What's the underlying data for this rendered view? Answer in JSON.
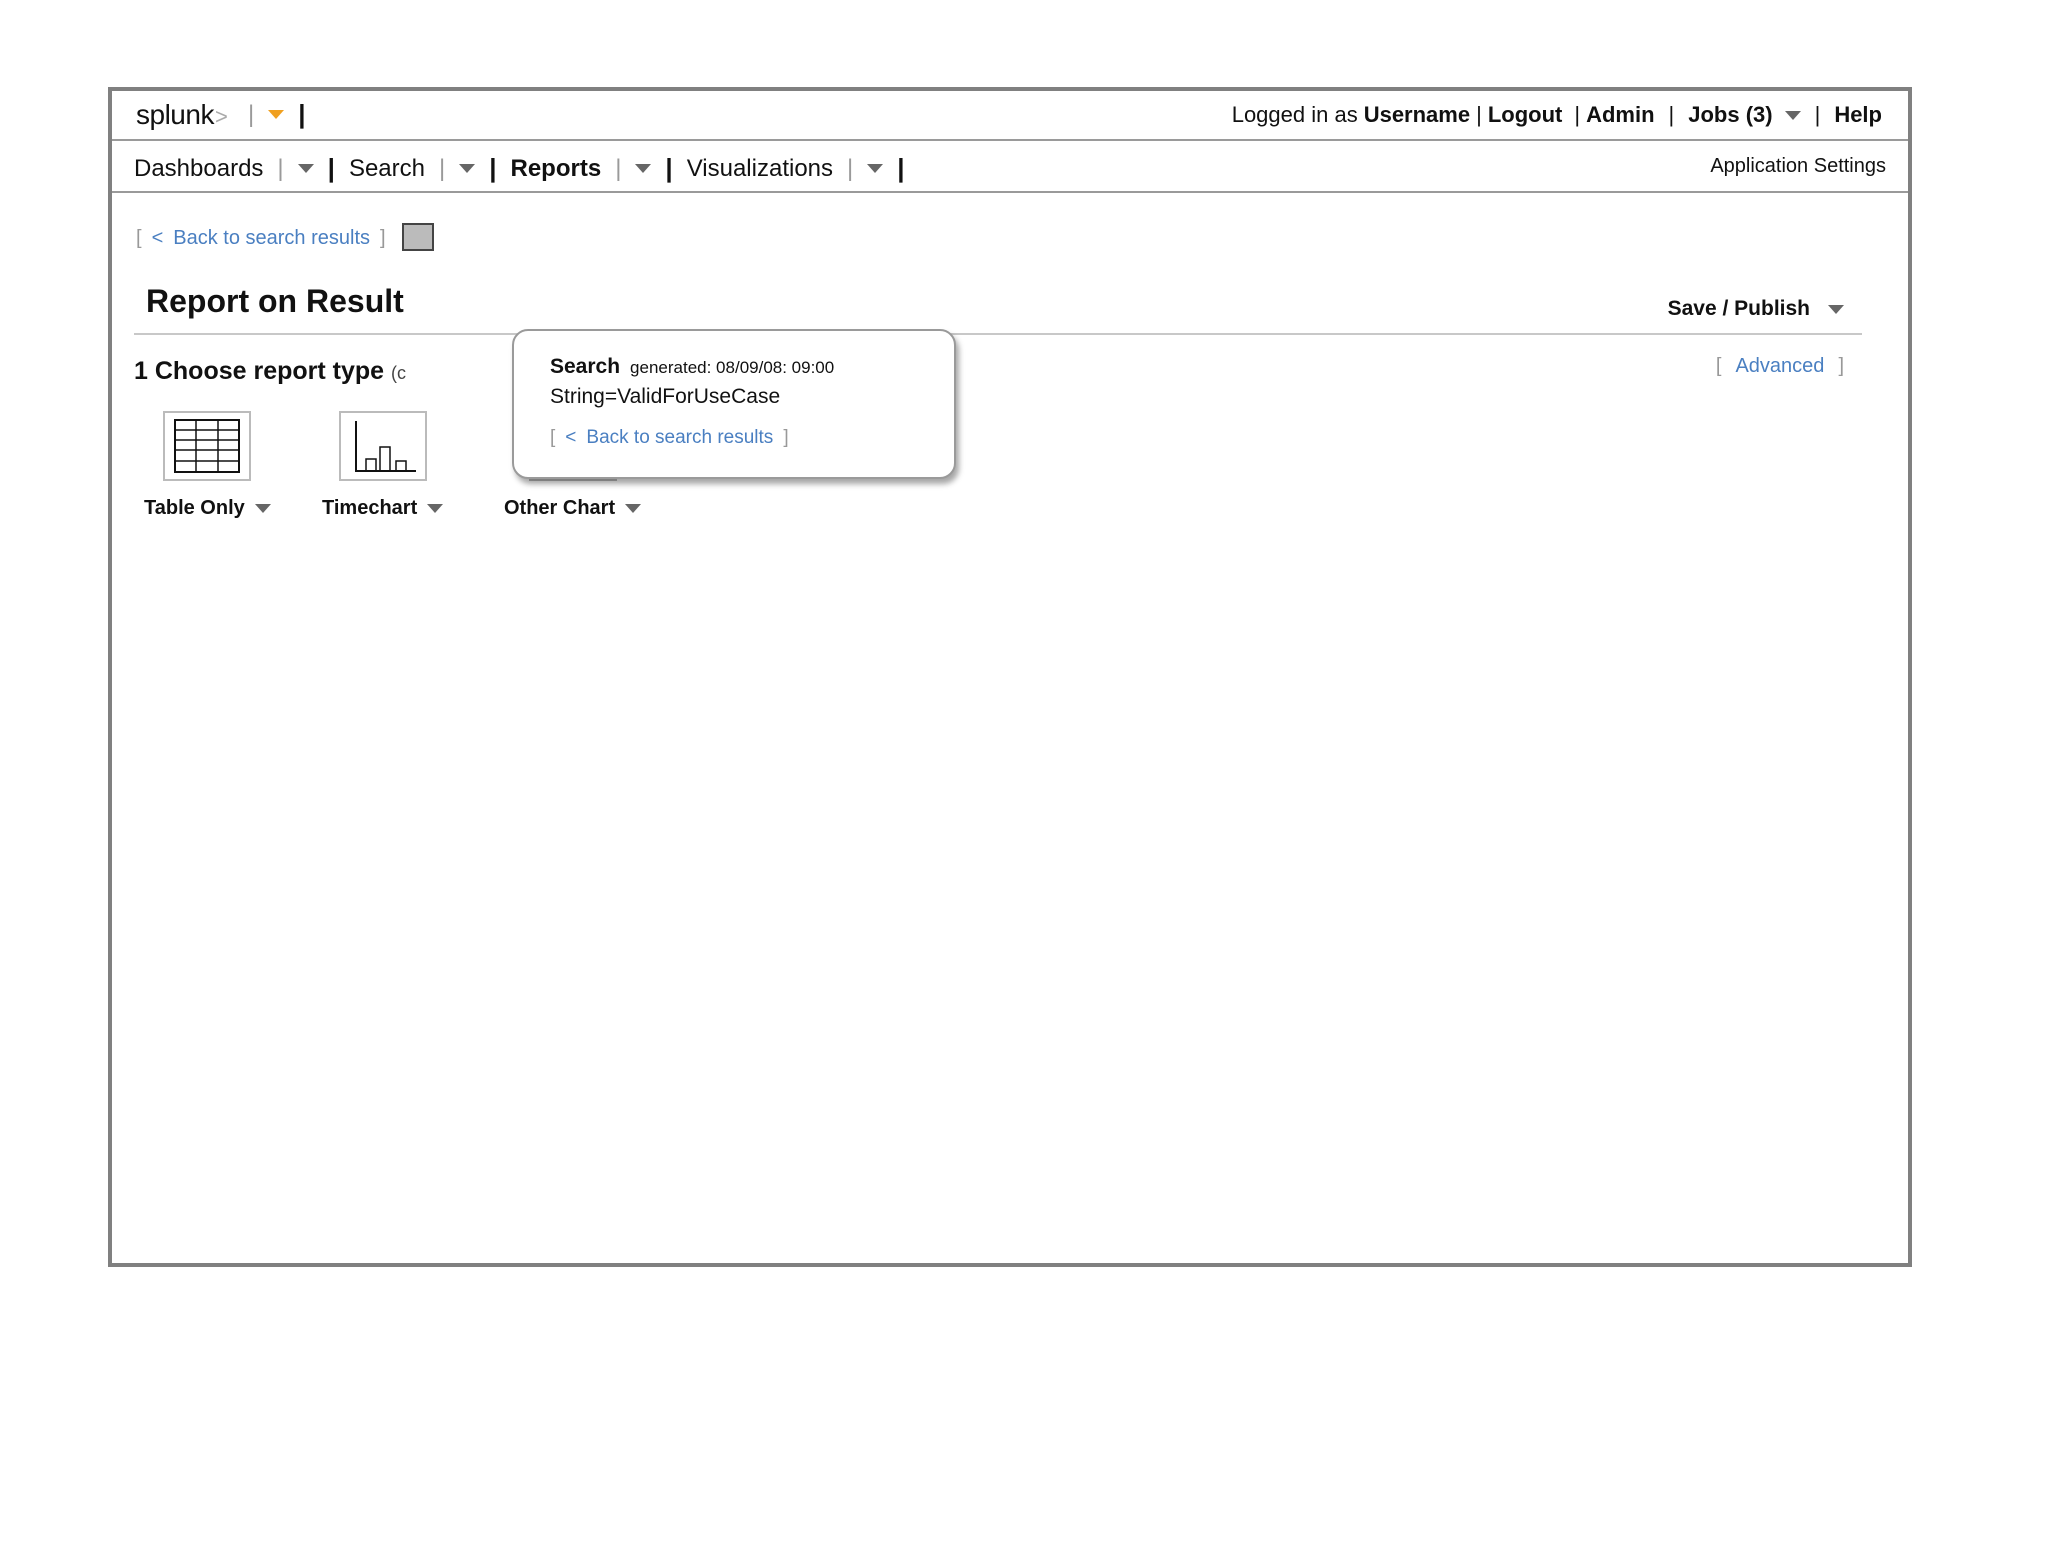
{
  "topbar": {
    "logo": "splunk",
    "logo_suffix": ">",
    "user_prefix": "Logged in as",
    "username": "Username",
    "logout": "Logout",
    "admin": "Admin",
    "jobs": "Jobs (3)",
    "help": "Help"
  },
  "nav": {
    "items": [
      {
        "label": "Dashboards",
        "active": false
      },
      {
        "label": "Search",
        "active": false
      },
      {
        "label": "Reports",
        "active": true
      },
      {
        "label": "Visualizations",
        "active": false
      }
    ],
    "app_settings": "Application Settings"
  },
  "back_link": {
    "arrow": "<",
    "label": "Back to search results"
  },
  "page": {
    "title": "Report on Result",
    "save_publish": "Save / Publish",
    "advanced": "Advanced"
  },
  "step": {
    "label": "1 Choose report type",
    "hint": "(c"
  },
  "report_types": [
    {
      "label": "Table Only",
      "icon": "table-icon"
    },
    {
      "label": "Timechart",
      "icon": "bar-chart-icon"
    },
    {
      "label": "Other Chart",
      "icon": "bar-chart-icon"
    }
  ],
  "popup": {
    "title": "Search",
    "generated": "generated: 08/09/08: 09:00",
    "query": "String=ValidForUseCase",
    "link_arrow": "<",
    "link_label": "Back to search results"
  },
  "colors": {
    "link": "#4a7fc1",
    "accent_orange": "#f0a020",
    "frame_border": "#808080"
  }
}
